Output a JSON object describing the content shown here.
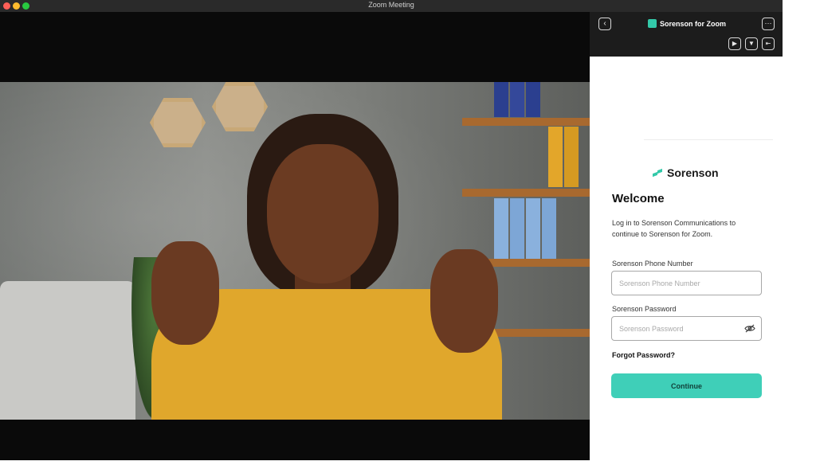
{
  "window": {
    "title": "Zoom Meeting"
  },
  "zoom_panel": {
    "app_name": "Sorenson for Zoom",
    "back_icon": "chevron-left-icon",
    "more_icon": "ellipsis-icon",
    "tools": [
      "video-icon",
      "filter-icon",
      "collapse-panel-icon"
    ]
  },
  "login": {
    "brand": "Sorenson",
    "heading": "Welcome",
    "intro": "Log in to Sorenson Communications to continue to Sorenson for Zoom.",
    "phone_label": "Sorenson Phone Number",
    "phone_placeholder": "Sorenson Phone Number",
    "password_label": "Sorenson Password",
    "password_placeholder": "Sorenson Password",
    "forgot": "Forgot Password?",
    "continue": "Continue"
  },
  "colors": {
    "accent": "#3fcfb8",
    "header_bg": "#1c1c1c"
  }
}
